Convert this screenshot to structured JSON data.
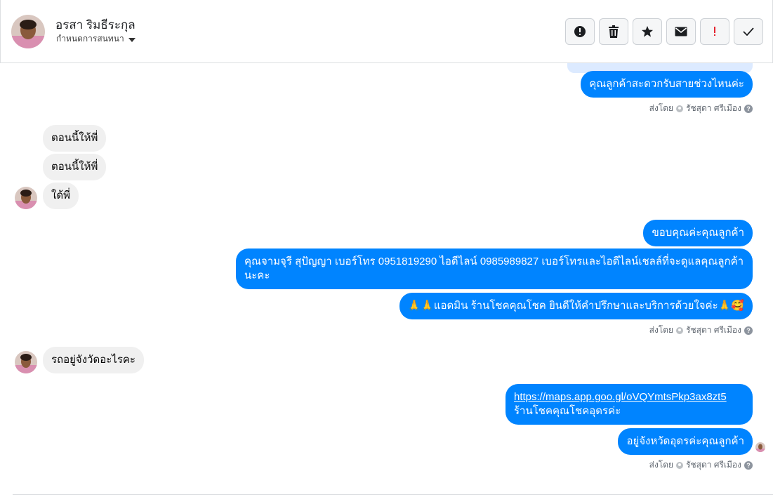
{
  "header": {
    "name": "อรสา ริมธีระกุล",
    "subtitle": "กำหนดการสนทนา",
    "avatar_icon": "user-avatar-photo"
  },
  "toolbar": {
    "buttons": [
      {
        "icon": "alert-circle-icon",
        "label": "Report"
      },
      {
        "icon": "trash-icon",
        "label": "Delete"
      },
      {
        "icon": "star-icon",
        "label": "Star"
      },
      {
        "icon": "envelope-icon",
        "label": "Mark unread"
      },
      {
        "icon": "exclamation-icon",
        "label": "Spam"
      },
      {
        "icon": "checkmark-icon",
        "label": "Done"
      }
    ]
  },
  "messages": {
    "m1": "คุณลูกค้าสะดวกรับสายช่วงไหนค่ะ",
    "m2": "ตอนนี้ให้พี่",
    "m3": "ตอนนี้ให้พี่",
    "m4": "ใด้พี่",
    "m5": "ขอบคุณค่ะคุณลูกค้า",
    "m6": "คุณจามจุรี สุปัญญา เบอร์โทร 0951819290  ไอดีไลน์ 0985989827   เบอร์โทรและไอดีไลน์เชลล์ที่จะดูแลคุณลูกค้านะคะ",
    "m7": "🙏🙏แอดมิน ร้านโชคคุณโชค ยินดีให้คำปรึกษาและบริการด้วยใจค่ะ🙏🥰",
    "m8": "รถอยู่จังวัดอะไรคะ",
    "m9_link": "https://maps.app.goo.gl/oVQYmtsPkp3ax8zt5",
    "m9_text": "ร้านโชคคุณโชคอุดรค่ะ",
    "m10": "อยู่จังหวัดอุดรค่ะคุณลูกค้า"
  },
  "sent_by": {
    "prefix": "ส่งโดย",
    "agent": "รัชสุดา ศรีเมือง"
  },
  "colors": {
    "outgoing_bubble": "#0084ff",
    "incoming_bubble": "#f0f0f0"
  }
}
